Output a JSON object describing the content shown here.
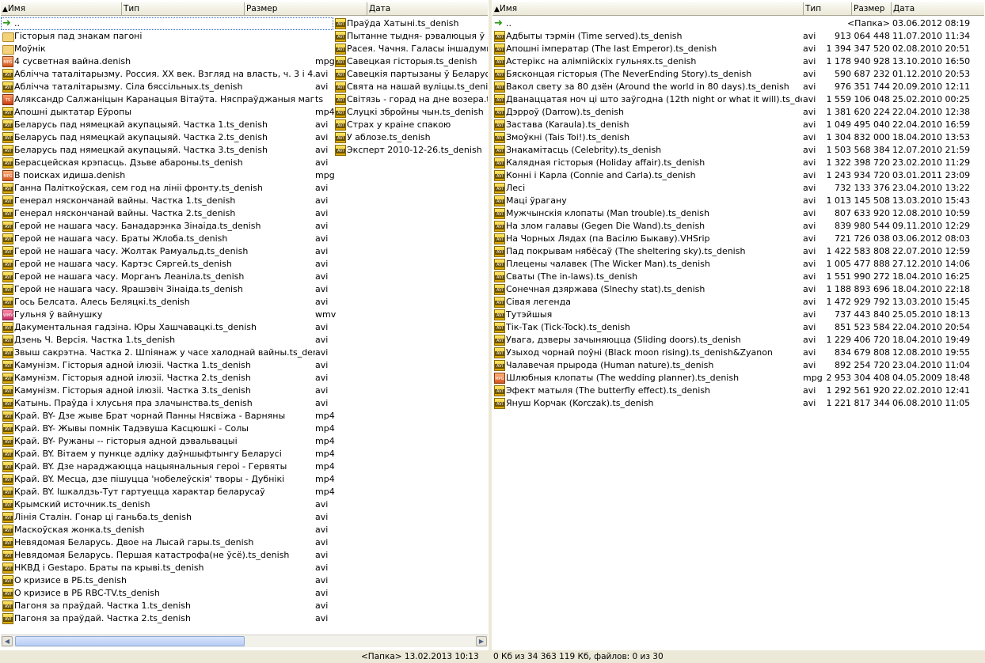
{
  "left": {
    "headers": {
      "name": "Имя",
      "type": "Тип",
      "size": "Размер",
      "date": "Дата"
    },
    "col1": [
      {
        "icon": "up-icon",
        "name": "..",
        "type": "",
        "selected": true
      },
      {
        "icon": "folder-icon",
        "name": "Гісторыя пад знакам пагоні",
        "type": ""
      },
      {
        "icon": "folder-icon",
        "name": "Моўнік",
        "type": ""
      },
      {
        "icon": "mpg-icon",
        "name": "4 сусветная вайна.denish",
        "type": "mpg"
      },
      {
        "icon": "avi-icon",
        "name": "Абліччa таталітарызму. Россия. XX век. Взгляд на власть, ч. 3 і 4.ts_denish",
        "type": "avi"
      },
      {
        "icon": "avi-icon",
        "name": "Абліччa таталітарызму. Сіла бяссільных.ts_denish",
        "type": "avi"
      },
      {
        "icon": "ts-icon",
        "name": "Аляксандр Салжаніцын Каранацыя Вітаўта. Няспраўджаныя магчымасці",
        "type": "ts"
      },
      {
        "icon": "avi-icon",
        "name": "Апошні дыктатар Еўропы",
        "type": "mp4"
      },
      {
        "icon": "avi-icon",
        "name": "Беларусь пад нямецкай акупацыяй. Частка 1.ts_denish",
        "type": "avi"
      },
      {
        "icon": "avi-icon",
        "name": "Беларусь пад нямецкай акупацыяй. Частка 2.ts_denish",
        "type": "avi"
      },
      {
        "icon": "avi-icon",
        "name": "Беларусь пад нямецкай акупацыяй. Частка 3.ts_denish",
        "type": "avi"
      },
      {
        "icon": "avi-icon",
        "name": "Берасцейская крэпасць. Дзьве абароны.ts_denish",
        "type": "avi"
      },
      {
        "icon": "mpg-icon",
        "name": "В поисках идиша.denish",
        "type": "mpg"
      },
      {
        "icon": "avi-icon",
        "name": "Ганна Паліткоўская, сем год на лініі фронту.ts_denish",
        "type": "avi"
      },
      {
        "icon": "avi-icon",
        "name": "Генерал няскончанай вайны. Частка 1.ts_denish",
        "type": "avi"
      },
      {
        "icon": "avi-icon",
        "name": "Генерал няскончанай вайны. Частка 2.ts_denish",
        "type": "avi"
      },
      {
        "icon": "avi-icon",
        "name": "Герой не нашага часу. Банадарэнка Зінаіда.ts_denish",
        "type": "avi"
      },
      {
        "icon": "avi-icon",
        "name": "Герой не нашага часу. Браты Жлоба.ts_denish",
        "type": "avi"
      },
      {
        "icon": "avi-icon",
        "name": "Герой не нашага часу. Жолтак Рамуальд.ts_denish",
        "type": "avi"
      },
      {
        "icon": "avi-icon",
        "name": "Герой не нашага часу. Картэс Сяргей.ts_denish",
        "type": "avi"
      },
      {
        "icon": "avi-icon",
        "name": "Герой не нашага часу. Морганъ Леаніла.ts_denish",
        "type": "avi"
      },
      {
        "icon": "avi-icon",
        "name": "Герой не нашага часу. Ярашэвіч Зінаіда.ts_denish",
        "type": "avi"
      },
      {
        "icon": "avi-icon",
        "name": "Гось Белсата. Алесь Беляцкі.ts_denish",
        "type": "avi"
      },
      {
        "icon": "wmv-icon",
        "name": "Гульня ў вайнушку",
        "type": "wmv"
      },
      {
        "icon": "avi-icon",
        "name": "Дакументальная гадзіна. Юры Хашчавацкі.ts_denish",
        "type": "avi"
      },
      {
        "icon": "avi-icon",
        "name": "Дзень Ч. Версія. Частка 1.ts_denish",
        "type": "avi"
      },
      {
        "icon": "avi-icon",
        "name": "Звыш сакрэтна. Частка 2. Шпіянаж у часе халоднай вайны.ts_denish",
        "type": "avi"
      },
      {
        "icon": "avi-icon",
        "name": "Камунізм. Гісторыя адной ілюзіі. Частка 1.ts_denish",
        "type": "avi"
      },
      {
        "icon": "avi-icon",
        "name": "Камунізм. Гісторыя адной ілюзіі. Частка 2.ts_denish",
        "type": "avi"
      },
      {
        "icon": "avi-icon",
        "name": "Камунізм. Гісторыя адной ілюзіі. Частка 3.ts_denish",
        "type": "avi"
      },
      {
        "icon": "avi-icon",
        "name": "Катынь. Праўда і хлусьня пра злачынства.ts_denish",
        "type": "avi"
      },
      {
        "icon": "avi-icon",
        "name": "Край. BY- Дзе жыве Брат чорнай Панны Нясвіжа - Варняны",
        "type": "mp4"
      },
      {
        "icon": "avi-icon",
        "name": "Край. BY- Жывы помнік Тадэвуша Касцюшкі - Солы",
        "type": "mp4"
      },
      {
        "icon": "avi-icon",
        "name": "Край. BY- Ружаны -- гісторыя адной дэвальвацыі",
        "type": "mp4"
      },
      {
        "icon": "avi-icon",
        "name": "Край. BY. Вітаем у пункце адліку даўншыфтынгу Беларусі",
        "type": "mp4"
      },
      {
        "icon": "avi-icon",
        "name": "Край. BY. Дзе нараджаюцца нацыянальныя героі - Гервяты",
        "type": "mp4"
      },
      {
        "icon": "avi-icon",
        "name": "Край. BY. Месца, дзе пішуцца 'нобелеўскія' творы - Дубнікі",
        "type": "mp4"
      },
      {
        "icon": "avi-icon",
        "name": "Край. BY. Ішкалдзь-Тут гартуецца характар беларусаў",
        "type": "mp4"
      },
      {
        "icon": "avi-icon",
        "name": "Крымский источник.ts_denish",
        "type": "avi"
      },
      {
        "icon": "avi-icon",
        "name": "Лінія Сталін. Гонар ці ганьба.ts_denish",
        "type": "avi"
      },
      {
        "icon": "avi-icon",
        "name": "Маскоўская жонка.ts_denish",
        "type": "avi"
      },
      {
        "icon": "avi-icon",
        "name": "Невядомая Беларусь. Двое на Лысай гары.ts_denish",
        "type": "avi"
      },
      {
        "icon": "avi-icon",
        "name": "Невядомая Беларусь. Першая катастрофа(не ўсё).ts_denish",
        "type": "avi"
      },
      {
        "icon": "avi-icon",
        "name": "НКВД і Gestapo. Браты па крыві.ts_denish",
        "type": "avi"
      },
      {
        "icon": "avi-icon",
        "name": "О кризисе в РБ.ts_denish",
        "type": "avi"
      },
      {
        "icon": "avi-icon",
        "name": "О кризисе в РБ RBC-TV.ts_denish",
        "type": "avi"
      },
      {
        "icon": "avi-icon",
        "name": "Пагоня за праўдай. Частка 1.ts_denish",
        "type": "avi"
      },
      {
        "icon": "avi-icon",
        "name": "Пагоня за праўдай. Частка 2.ts_denish",
        "type": "avi"
      }
    ],
    "col2": [
      {
        "icon": "avi-icon",
        "name": "Праўда Хатыні.ts_denish"
      },
      {
        "icon": "avi-icon",
        "name": "Пытанне тыдня- рэвалюцыя ў Лівії"
      },
      {
        "icon": "avi-icon",
        "name": "Расея. Чачня. Галасы іншадумцаў."
      },
      {
        "icon": "avi-icon",
        "name": "Савецкая гісторыя.ts_denish"
      },
      {
        "icon": "avi-icon",
        "name": "Савецкія партызаны ў Беларусі бы"
      },
      {
        "icon": "avi-icon",
        "name": "Свята на нашай вуліцы.ts_denish"
      },
      {
        "icon": "avi-icon",
        "name": "Світязь - горад на дне возера.ts_d"
      },
      {
        "icon": "avi-icon",
        "name": "Слуцкі збройны чын.ts_denish"
      },
      {
        "icon": "avi-icon",
        "name": "Страх у краіне спакою"
      },
      {
        "icon": "avi-icon",
        "name": "У аблозе.ts_denish"
      },
      {
        "icon": "avi-icon",
        "name": "Эксперт 2010-12-26.ts_denish"
      }
    ],
    "status": "<Папка> 13.02.2013 10:13"
  },
  "right": {
    "headers": {
      "name": "Имя",
      "type": "Тип",
      "size": "Размер",
      "date": "Дата"
    },
    "rows": [
      {
        "icon": "up-icon",
        "name": "..",
        "type": "",
        "size": "<Папка>",
        "date": "03.06.2012 08:19"
      },
      {
        "icon": "avi-icon",
        "name": "Адбыты тэрмін (Time served).ts_denish",
        "type": "avi",
        "size": "913 064 448",
        "date": "11.07.2010 11:34"
      },
      {
        "icon": "avi-icon",
        "name": "Апошні імператар (The last Emperor).ts_denish",
        "type": "avi",
        "size": "1 394 347 520",
        "date": "02.08.2010 20:51"
      },
      {
        "icon": "avi-icon",
        "name": "Астерікс на алімпійскіх гульнях.ts_denish",
        "type": "avi",
        "size": "1 178 940 928",
        "date": "13.10.2010 16:50"
      },
      {
        "icon": "avi-icon",
        "name": "Бясконцая гісторыя (The NeverEnding Story).ts_denish",
        "type": "avi",
        "size": "590 687 232",
        "date": "01.12.2010 20:53"
      },
      {
        "icon": "avi-icon",
        "name": "Вакол свету за 80 дзён (Around the world in 80 days).ts_denish",
        "type": "avi",
        "size": "976 351 744",
        "date": "20.09.2010 12:11"
      },
      {
        "icon": "avi-icon",
        "name": "Дванаццатая ноч ці што заўгодна (12th night or what it will).ts_denish",
        "type": "avi",
        "size": "1 559 106 048",
        "date": "25.02.2010 00:25"
      },
      {
        "icon": "avi-icon",
        "name": "Дэрроў (Darrow).ts_denish",
        "type": "avi",
        "size": "1 381 620 224",
        "date": "22.04.2010 12:38"
      },
      {
        "icon": "avi-icon",
        "name": "Застава (Karaula).ts_denish",
        "type": "avi",
        "size": "1 049 495 040",
        "date": "22.04.2010 16:59"
      },
      {
        "icon": "avi-icon",
        "name": "Змоўкні (Tais Toi!).ts_denish",
        "type": "avi",
        "size": "1 304 832 000",
        "date": "18.04.2010 13:53"
      },
      {
        "icon": "avi-icon",
        "name": "Знакамітасць (Celebrity).ts_denish",
        "type": "avi",
        "size": "1 503 568 384",
        "date": "12.07.2010 21:59"
      },
      {
        "icon": "avi-icon",
        "name": "Калядная гісторыя (Holiday affair).ts_denish",
        "type": "avi",
        "size": "1 322 398 720",
        "date": "23.02.2010 11:29"
      },
      {
        "icon": "avi-icon",
        "name": "Конні і Карла (Connie and Carla).ts_denish",
        "type": "avi",
        "size": "1 243 934 720",
        "date": "03.01.2011 23:09"
      },
      {
        "icon": "avi-icon",
        "name": "Лесі",
        "type": "avi",
        "size": "732 133 376",
        "date": "23.04.2010 13:22"
      },
      {
        "icon": "avi-icon",
        "name": "Маці ўрагану",
        "type": "avi",
        "size": "1 013 145 508",
        "date": "13.03.2010 15:43"
      },
      {
        "icon": "avi-icon",
        "name": "Мужчынскія клопаты (Man trouble).ts_denish",
        "type": "avi",
        "size": "807 633 920",
        "date": "12.08.2010 10:59"
      },
      {
        "icon": "avi-icon",
        "name": "На злом галавы (Gegen Die Wand).ts_denish",
        "type": "avi",
        "size": "839 980 544",
        "date": "09.11.2010 12:29"
      },
      {
        "icon": "avi-icon",
        "name": "На Чорных Лядах (па Васілю Быкаву).VHSrip",
        "type": "avi",
        "size": "721 726 038",
        "date": "03.06.2012 08:03"
      },
      {
        "icon": "avi-icon",
        "name": "Пад покрывам нябёсаў (The sheltering sky).ts_denish",
        "type": "avi",
        "size": "1 422 583 808",
        "date": "22.07.2010 12:59"
      },
      {
        "icon": "avi-icon",
        "name": "Плецены чалавек (The Wicker Man).ts_denish",
        "type": "avi",
        "size": "1 005 477 888",
        "date": "27.12.2010 14:06"
      },
      {
        "icon": "avi-icon",
        "name": "Сваты (The in-laws).ts_denish",
        "type": "avi",
        "size": "1 551 990 272",
        "date": "18.04.2010 16:25"
      },
      {
        "icon": "avi-icon",
        "name": "Сонечная дзяржава (Slnechy stat).ts_denish",
        "type": "avi",
        "size": "1 188 893 696",
        "date": "18.04.2010 22:18"
      },
      {
        "icon": "avi-icon",
        "name": "Сівая легенда",
        "type": "avi",
        "size": "1 472 929 792",
        "date": "13.03.2010 15:45"
      },
      {
        "icon": "avi-icon",
        "name": "Тутэйшыя",
        "type": "avi",
        "size": "737 443 840",
        "date": "25.05.2010 18:13"
      },
      {
        "icon": "avi-icon",
        "name": "Тік-Так (Tick-Tock).ts_denish",
        "type": "avi",
        "size": "851 523 584",
        "date": "22.04.2010 20:54"
      },
      {
        "icon": "avi-icon",
        "name": "Увага, дзверы зачыняюцца (Sliding doors).ts_denish",
        "type": "avi",
        "size": "1 229 406 720",
        "date": "18.04.2010 19:49"
      },
      {
        "icon": "avi-icon",
        "name": "Узыход чорнай поўні (Black moon rising).ts_denish&Zyanon",
        "type": "avi",
        "size": "834 679 808",
        "date": "12.08.2010 19:55"
      },
      {
        "icon": "avi-icon",
        "name": "Чалавечая прырода (Human nature).ts_denish",
        "type": "avi",
        "size": "892 254 720",
        "date": "23.04.2010 11:04"
      },
      {
        "icon": "mpg-icon",
        "name": "Шлюбныя клопаты (The wedding planner).ts_denish",
        "type": "mpg",
        "size": "2 953 304 408",
        "date": "04.05.2009 18:48"
      },
      {
        "icon": "avi-icon",
        "name": "Эфект матыля (The butterfly effect).ts_denish",
        "type": "avi",
        "size": "1 292 561 920",
        "date": "22.02.2010 12:41"
      },
      {
        "icon": "avi-icon",
        "name": "Януш Корчак (Korczak).ts_denish",
        "type": "avi",
        "size": "1 221 817 344",
        "date": "06.08.2010 11:05"
      }
    ],
    "status": "0 Кб из 34 363 119 Кб, файлов: 0 из 30"
  }
}
